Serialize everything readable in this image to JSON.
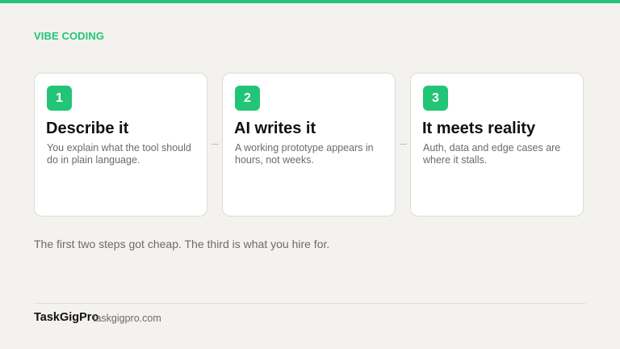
{
  "header": {
    "eyebrow": "VIBE CODING"
  },
  "steps": [
    {
      "number": "1",
      "title": "Describe it",
      "description": "You explain what the tool should do in plain language."
    },
    {
      "number": "2",
      "title": "AI writes it",
      "description": "A working prototype appears in hours, not weeks."
    },
    {
      "number": "3",
      "title": "It meets reality",
      "description": "Auth, data and edge cases are where it stalls."
    }
  ],
  "summary": "The first two steps got cheap. The third is what you hire for.",
  "footer": {
    "brand": "TaskGigPro",
    "url": "taskgigpro.com"
  },
  "colors": {
    "accent": "#22c576",
    "background": "#f3f2ef",
    "card": "#ffffff"
  }
}
